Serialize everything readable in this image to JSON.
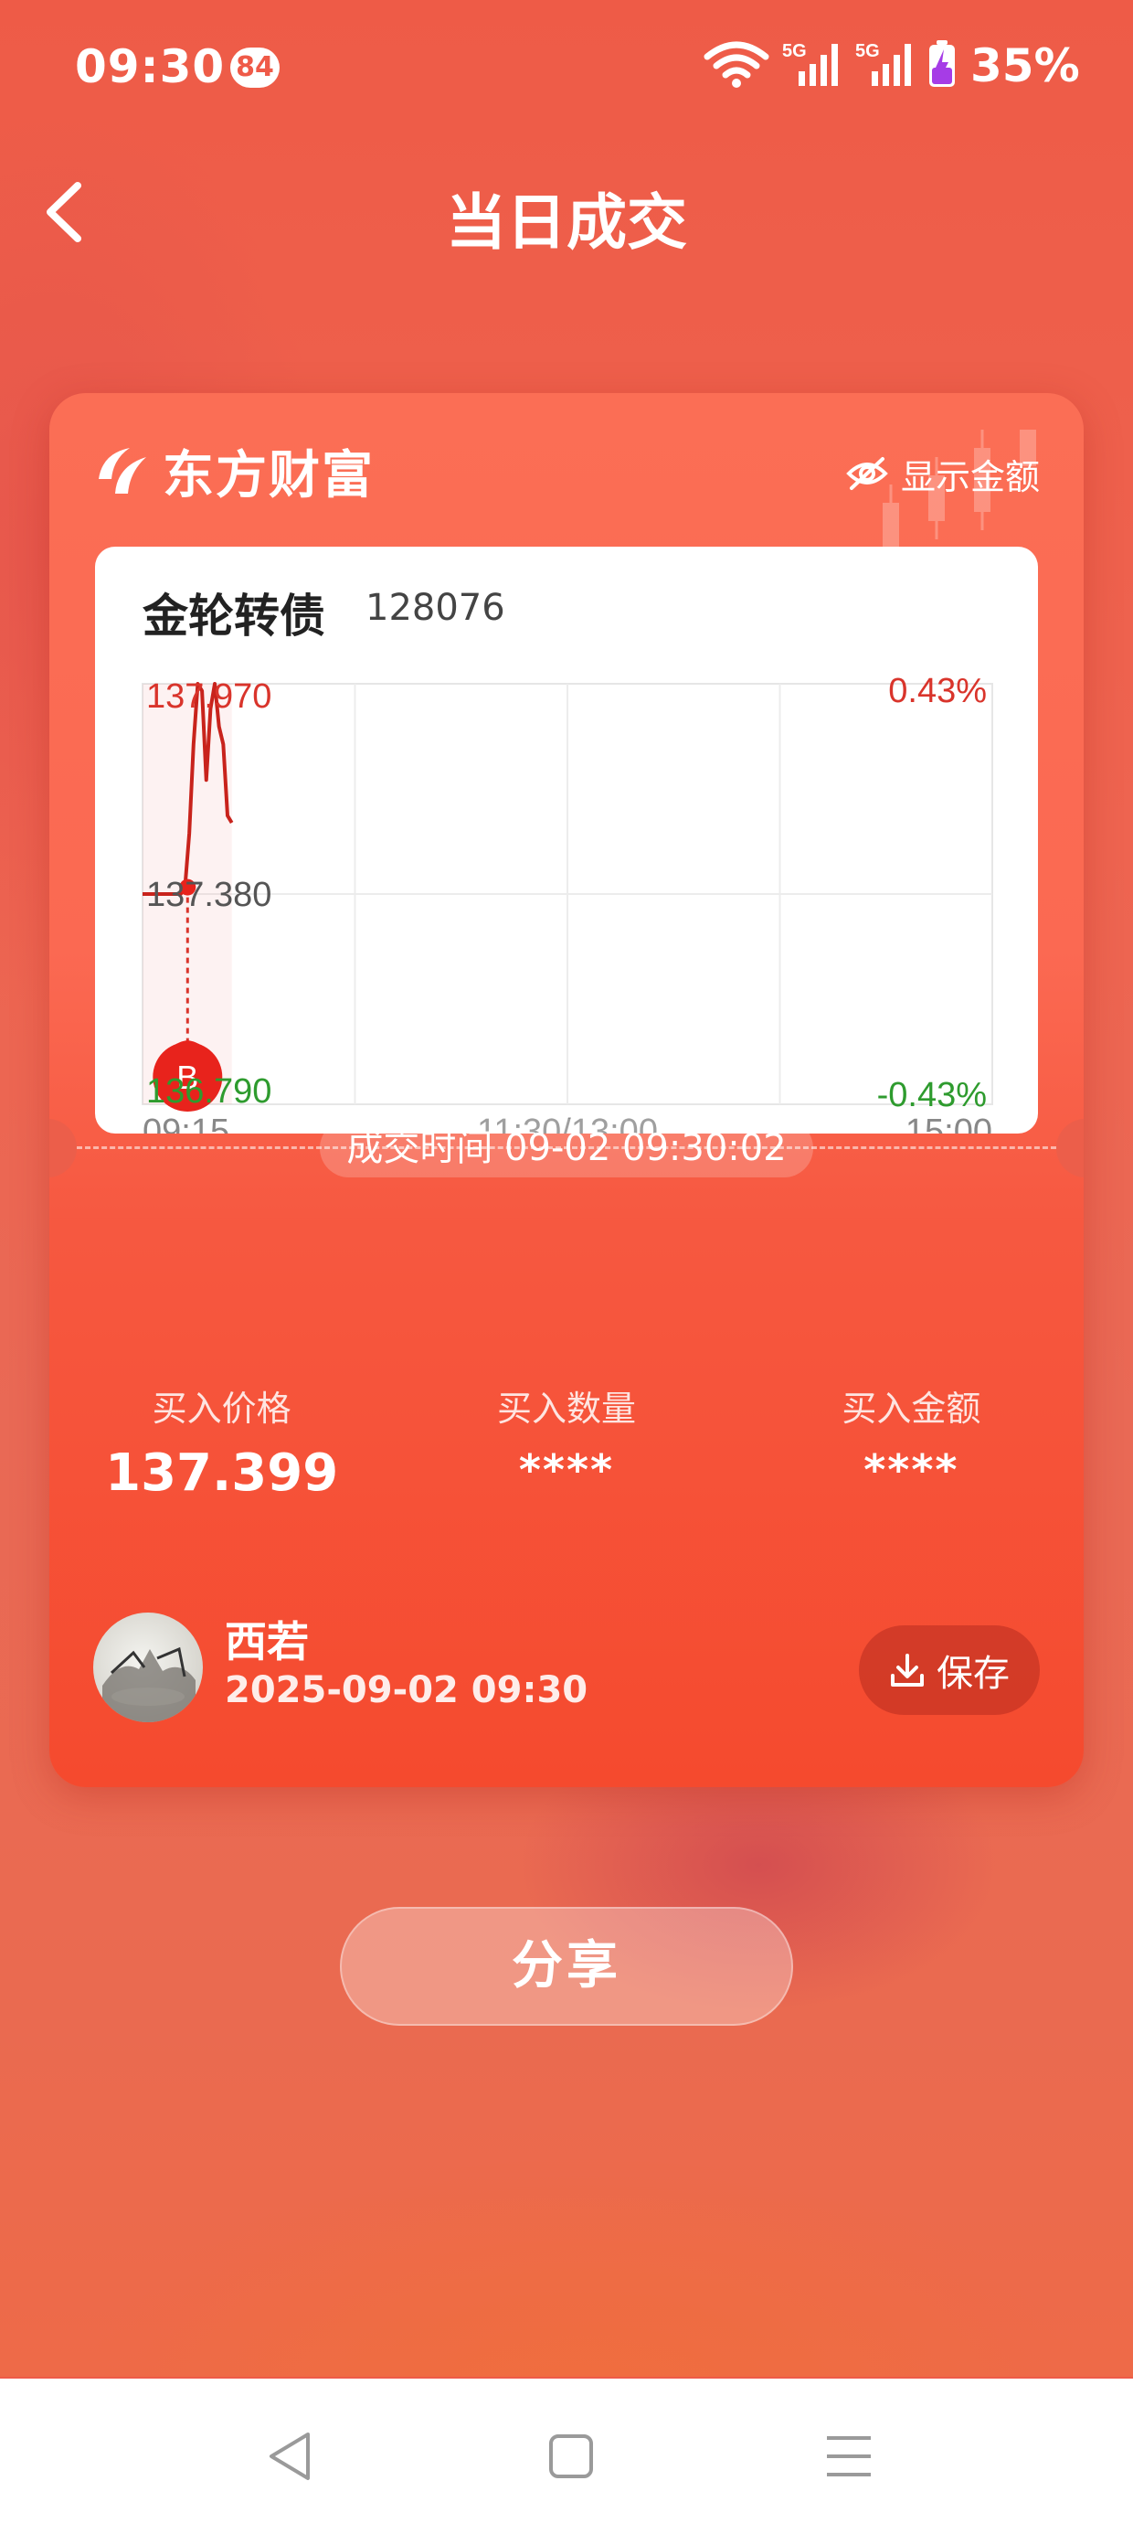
{
  "status_bar": {
    "time": "09:30",
    "notification_count": "84",
    "network_1": "5G",
    "network_2": "5G",
    "battery": "35%"
  },
  "header": {
    "title": "当日成交",
    "back_icon": "chevron-left-icon"
  },
  "card": {
    "brand": "东方财富",
    "show_amount_label": "显示金额",
    "show_amount_icon": "eye-off-icon",
    "stock": {
      "name": "金轮转债",
      "code": "128076"
    },
    "chart_data": {
      "type": "line",
      "y_labels": {
        "high": "137.970",
        "mid": "137.380",
        "low": "136.790"
      },
      "pct_labels": {
        "high": "0.43%",
        "low": "-0.43%"
      },
      "x_labels": [
        "09:15",
        "11:30/13:00",
        "15:00"
      ],
      "ylim": [
        136.79,
        137.97
      ],
      "series": [
        {
          "x": [
            0.0,
            0.03,
            0.045,
            0.05,
            0.055,
            0.06,
            0.065,
            0.07,
            0.075,
            0.08,
            0.085,
            0.09,
            0.095,
            0.1,
            0.105
          ],
          "values": [
            137.38,
            137.38,
            137.38,
            137.4,
            137.55,
            137.8,
            137.97,
            137.95,
            137.7,
            137.9,
            137.97,
            137.85,
            137.8,
            137.6,
            137.58
          ]
        }
      ],
      "buy_marker": {
        "label": "B",
        "price": 137.399
      },
      "grid": true
    },
    "trade_time": "成交时间 09-02 09:30:02",
    "stats": [
      {
        "label": "买入价格",
        "value": "137.399"
      },
      {
        "label": "买入数量",
        "value": "****"
      },
      {
        "label": "买入金额",
        "value": "****"
      }
    ],
    "user": {
      "name": "西若",
      "time": "2025-09-02 09:30"
    },
    "save_label": "保存",
    "save_icon": "download-icon"
  },
  "share_label": "分享",
  "nav": {
    "back_icon": "triangle-back-icon",
    "home_icon": "square-home-icon",
    "menu_icon": "menu-lines-icon"
  },
  "colors": {
    "accent": "#ef5a48",
    "up": "#d9342b",
    "down": "#2e9b2e",
    "line": "#c8231c"
  }
}
